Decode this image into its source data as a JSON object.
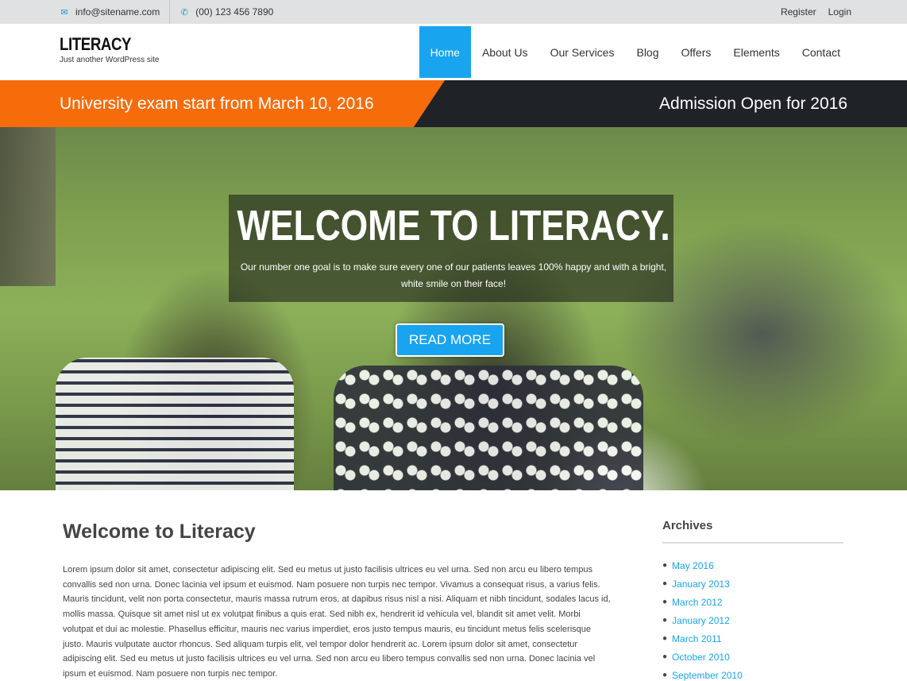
{
  "topbar": {
    "email": "info@sitename.com",
    "phone": "(00) 123 456 7890",
    "register_label": "Register",
    "login_label": "Login"
  },
  "header": {
    "logo": "LITERACY",
    "tagline": "Just another WordPress site",
    "nav": [
      {
        "label": "Home",
        "active": true
      },
      {
        "label": "About Us"
      },
      {
        "label": "Our Services"
      },
      {
        "label": "Blog"
      },
      {
        "label": "Offers"
      },
      {
        "label": "Elements"
      },
      {
        "label": "Contact"
      }
    ]
  },
  "ticker": {
    "left": "University exam start from March 10, 2016",
    "right": "Admission Open for 2016"
  },
  "hero": {
    "title": "WELCOME TO LITERACY.",
    "subtitle": "Our number one goal is to make sure every one of our patients leaves 100% happy and with a bright, white smile on their face!",
    "cta_label": "READ MORE"
  },
  "main": {
    "heading": "Welcome to Literacy",
    "body": "Lorem ipsum dolor sit amet, consectetur adipiscing elit. Sed eu metus ut justo facilisis ultrices eu vel urna. Sed non arcu eu libero tempus convallis sed non urna. Donec lacinia vel ipsum et euismod. Nam posuere non turpis nec tempor. Vivamus a consequat risus, a varius felis. Mauris tincidunt, velit non porta consectetur, mauris massa rutrum eros, at dapibus risus nisl a nisi. Aliquam et nibh tincidunt, sodales lacus id, mollis massa. Quisque sit amet nisl ut ex volutpat finibus a quis erat. Sed nibh ex, hendrerit id vehicula vel, blandit sit amet velit. Morbi volutpat et dui ac molestie. Phasellus efficitur, mauris nec varius imperdiet, eros justo tempus mauris, eu tincidunt metus felis scelerisque justo. Mauris vulputate auctor rhoncus. Sed aliquam turpis elit, vel tempor dolor hendrerit ac. Lorem ipsum dolor sit amet, consectetur adipiscing elit. Sed eu metus ut justo facilisis ultrices eu vel urna. Sed non arcu eu libero tempus convallis sed non urna. Donec lacinia vel ipsum et euismod. Nam posuere non turpis nec tempor."
  },
  "sidebar": {
    "archives_title": "Archives",
    "archives": [
      "May 2016",
      "January 2013",
      "March 2012",
      "January 2012",
      "March 2011",
      "October 2010",
      "September 2010"
    ]
  },
  "colors": {
    "accent": "#18a4ee",
    "ticker_orange": "#f66c0b",
    "ticker_dark": "#1f2327",
    "topbar_bg": "#dfe1e3"
  },
  "icons": {
    "email": "envelope-icon",
    "phone": "phone-icon"
  }
}
